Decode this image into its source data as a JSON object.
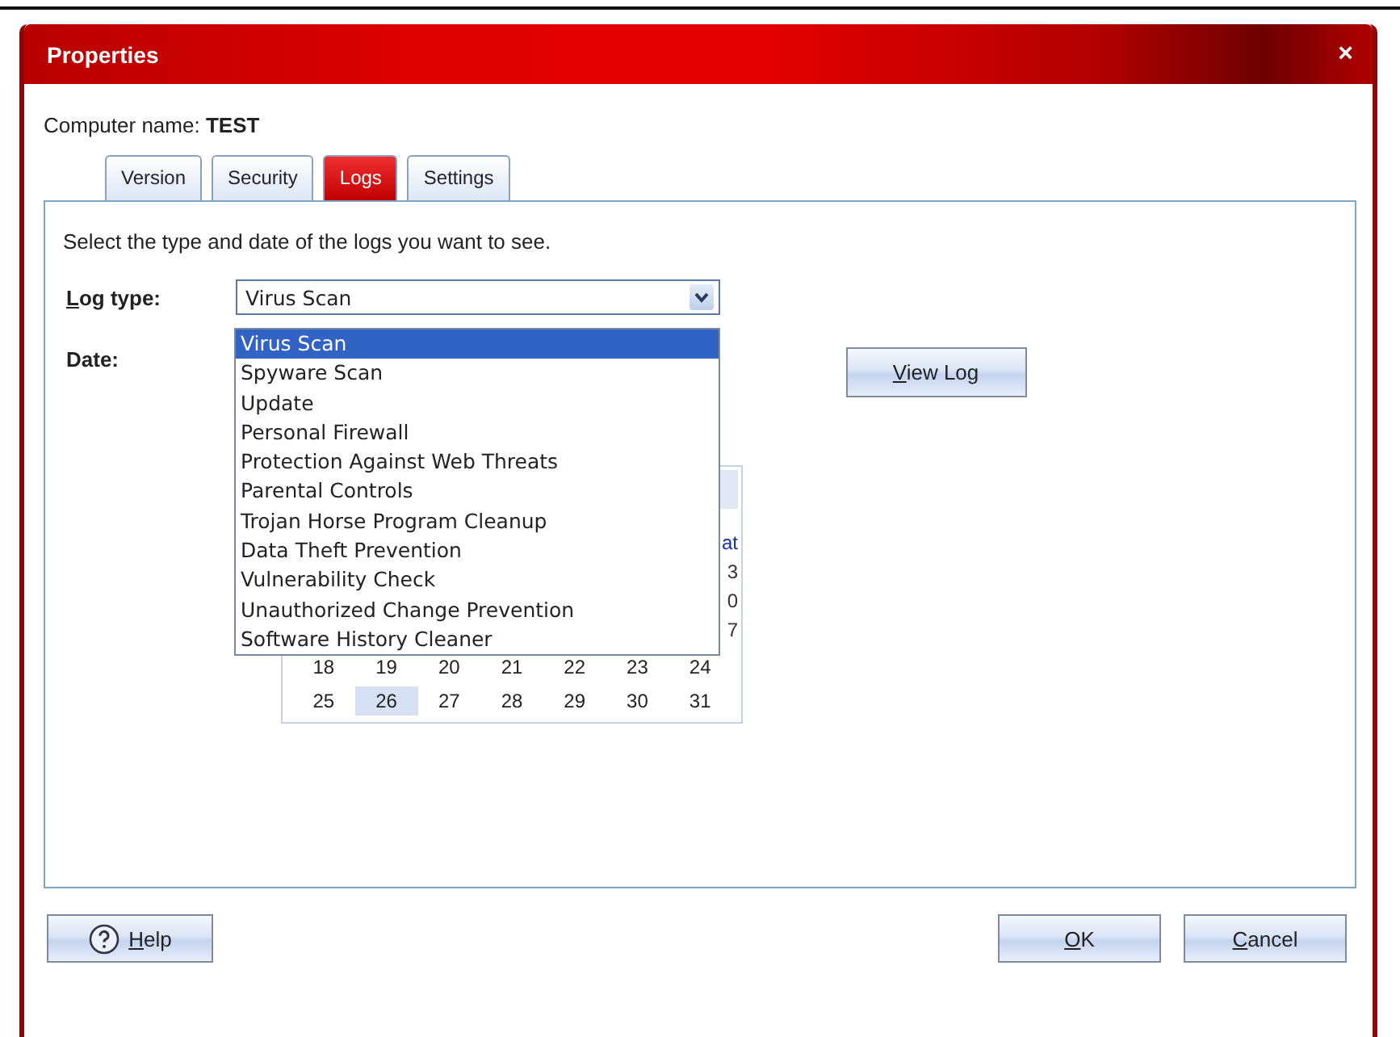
{
  "window": {
    "title": "Properties",
    "close": "×"
  },
  "computer": {
    "label": "Computer name:",
    "name": "TEST"
  },
  "tabs": [
    {
      "label": "Version",
      "selected": false
    },
    {
      "label": "Security",
      "selected": false
    },
    {
      "label": "Logs",
      "selected": true
    },
    {
      "label": "Settings",
      "selected": false
    }
  ],
  "instruction": "Select the type and date of the logs you want to see.",
  "log_type": {
    "label": "Log type:",
    "value": "Virus Scan",
    "expanded": true,
    "options": [
      {
        "label": "Virus Scan",
        "selected": true
      },
      {
        "label": "Spyware Scan",
        "selected": false
      },
      {
        "label": "Update",
        "selected": false
      },
      {
        "label": "Personal Firewall",
        "selected": false
      },
      {
        "label": "Protection Against Web Threats",
        "selected": false
      },
      {
        "label": "Parental Controls",
        "selected": false
      },
      {
        "label": "Trojan Horse Program Cleanup",
        "selected": false
      },
      {
        "label": "Data Theft Prevention",
        "selected": false
      },
      {
        "label": "Vulnerability Check",
        "selected": false
      },
      {
        "label": "Unauthorized Change Prevention",
        "selected": false
      },
      {
        "label": "Software History Cleaner",
        "selected": false
      }
    ]
  },
  "date": {
    "label": "Date:"
  },
  "view_log_button": "View Log",
  "calendar": {
    "visible_edge": [
      "at",
      "3",
      "0",
      "7"
    ],
    "weeks": [
      [
        {
          "day": "18",
          "selected": false
        },
        {
          "day": "19",
          "selected": false
        },
        {
          "day": "20",
          "selected": false
        },
        {
          "day": "21",
          "selected": false
        },
        {
          "day": "22",
          "selected": false
        },
        {
          "day": "23",
          "selected": false
        },
        {
          "day": "24",
          "selected": false
        }
      ],
      [
        {
          "day": "25",
          "selected": false
        },
        {
          "day": "26",
          "selected": true
        },
        {
          "day": "27",
          "selected": false
        },
        {
          "day": "28",
          "selected": false
        },
        {
          "day": "29",
          "selected": false
        },
        {
          "day": "30",
          "selected": false
        },
        {
          "day": "31",
          "selected": false
        }
      ]
    ]
  },
  "buttons": {
    "help": "Help",
    "ok": "OK",
    "cancel": "Cancel"
  }
}
